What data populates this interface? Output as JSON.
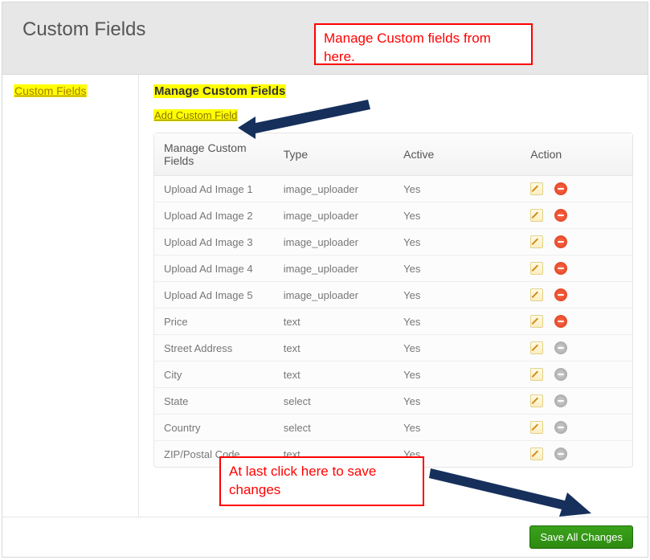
{
  "header": {
    "title": "Custom Fields"
  },
  "sidebar": {
    "link_label": "Custom Fields"
  },
  "section": {
    "title": "Manage Custom Fields",
    "add_link": "Add Custom Field"
  },
  "table": {
    "headers": {
      "name": "Manage Custom Fields",
      "type": "Type",
      "active": "Active",
      "action": "Action"
    },
    "rows": [
      {
        "name": "Upload Ad Image 1",
        "type": "image_uploader",
        "active": "Yes",
        "deletable": true
      },
      {
        "name": "Upload Ad Image 2",
        "type": "image_uploader",
        "active": "Yes",
        "deletable": true
      },
      {
        "name": "Upload Ad Image 3",
        "type": "image_uploader",
        "active": "Yes",
        "deletable": true
      },
      {
        "name": "Upload Ad Image 4",
        "type": "image_uploader",
        "active": "Yes",
        "deletable": true
      },
      {
        "name": "Upload Ad Image 5",
        "type": "image_uploader",
        "active": "Yes",
        "deletable": true
      },
      {
        "name": "Price",
        "type": "text",
        "active": "Yes",
        "deletable": true
      },
      {
        "name": "Street Address",
        "type": "text",
        "active": "Yes",
        "deletable": false
      },
      {
        "name": "City",
        "type": "text",
        "active": "Yes",
        "deletable": false
      },
      {
        "name": "State",
        "type": "select",
        "active": "Yes",
        "deletable": false
      },
      {
        "name": "Country",
        "type": "select",
        "active": "Yes",
        "deletable": false
      },
      {
        "name": "ZIP/Postal Code",
        "type": "text",
        "active": "Yes",
        "deletable": false
      }
    ]
  },
  "footer": {
    "save_label": "Save All Changes"
  },
  "callouts": {
    "top": "Manage Custom fields from here.",
    "bottom": "At last click here to save changes"
  }
}
